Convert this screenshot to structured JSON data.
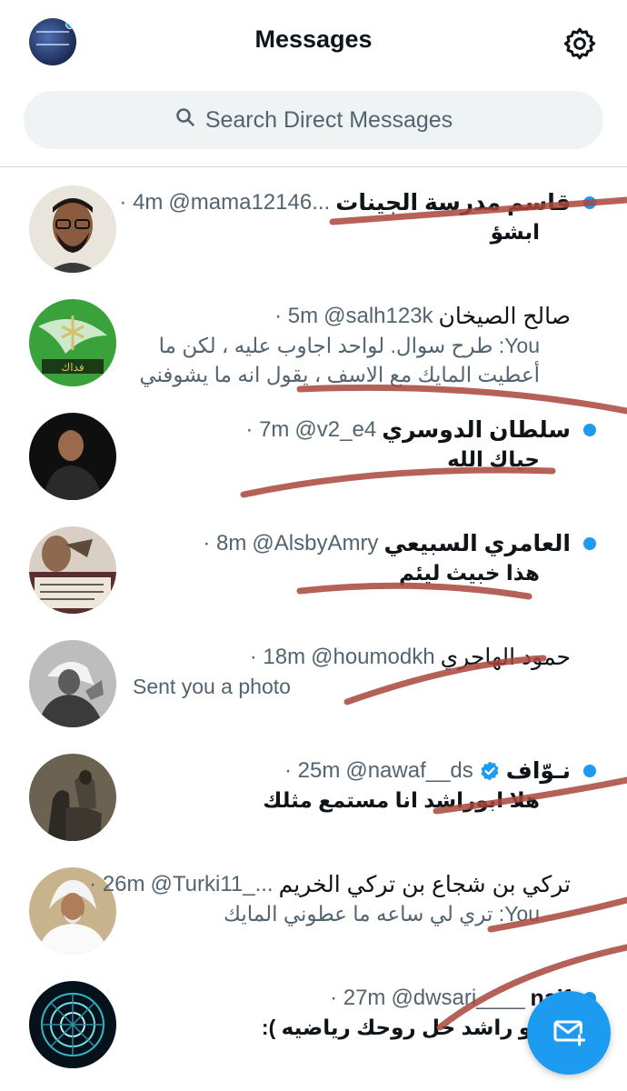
{
  "header": {
    "title": "Messages",
    "settings_icon": "gear-icon",
    "avatar_icon": "profile-avatar"
  },
  "search": {
    "placeholder": "Search Direct Messages",
    "icon": "search-icon"
  },
  "colors": {
    "accent": "#1d9bf0",
    "secondary_text": "#536471",
    "scribble": "#a9463c"
  },
  "conversations": [
    {
      "name": "قاسم مدرسة الجينات",
      "handle": "@mama12146...",
      "time": "· 4m",
      "preview": "ابشؤ",
      "unread": true
    },
    {
      "name": "صالح الصيخان",
      "handle": "@salh123k",
      "time": "· 5m",
      "preview": "You: طرح سوال. لواحد اجاوب عليه ، لكن ما",
      "preview2": "أعطيت المايك مع الاسف ، يقول انه ما يشوفني",
      "unread": false
    },
    {
      "name": "سلطان الدوسري",
      "handle": "@v2_e4",
      "time": "· 7m",
      "preview": "حياك الله",
      "unread": true
    },
    {
      "name": "العامري السبيعي",
      "handle": "@AlsbyAmry",
      "time": "· 8m",
      "preview": "هذا خبيث ليئم",
      "unread": true
    },
    {
      "name": "حمود الهاجري",
      "handle": "@houmodkh",
      "time": "· 18m",
      "preview": "Sent you a photo",
      "unread": false
    },
    {
      "name": "نـوّاف",
      "handle": "@nawaf__ds",
      "time": "· 25m",
      "preview": "هلا ابوراشد انا مستمع مثلك",
      "unread": true,
      "verified": true
    },
    {
      "name": "تركي بن شجاع بن تركي الخريم",
      "handle": "@Turki11_...",
      "time": "· 26m",
      "preview": "You: تري لي ساعه ما عطوني المايك",
      "unread": false
    },
    {
      "name": "naif",
      "handle": "@dwsari____",
      "time": "· 27m",
      "preview": "بو راشد خل روحك رياضيه ):",
      "unread": true
    }
  ],
  "fab": {
    "icon": "new-message-icon"
  }
}
